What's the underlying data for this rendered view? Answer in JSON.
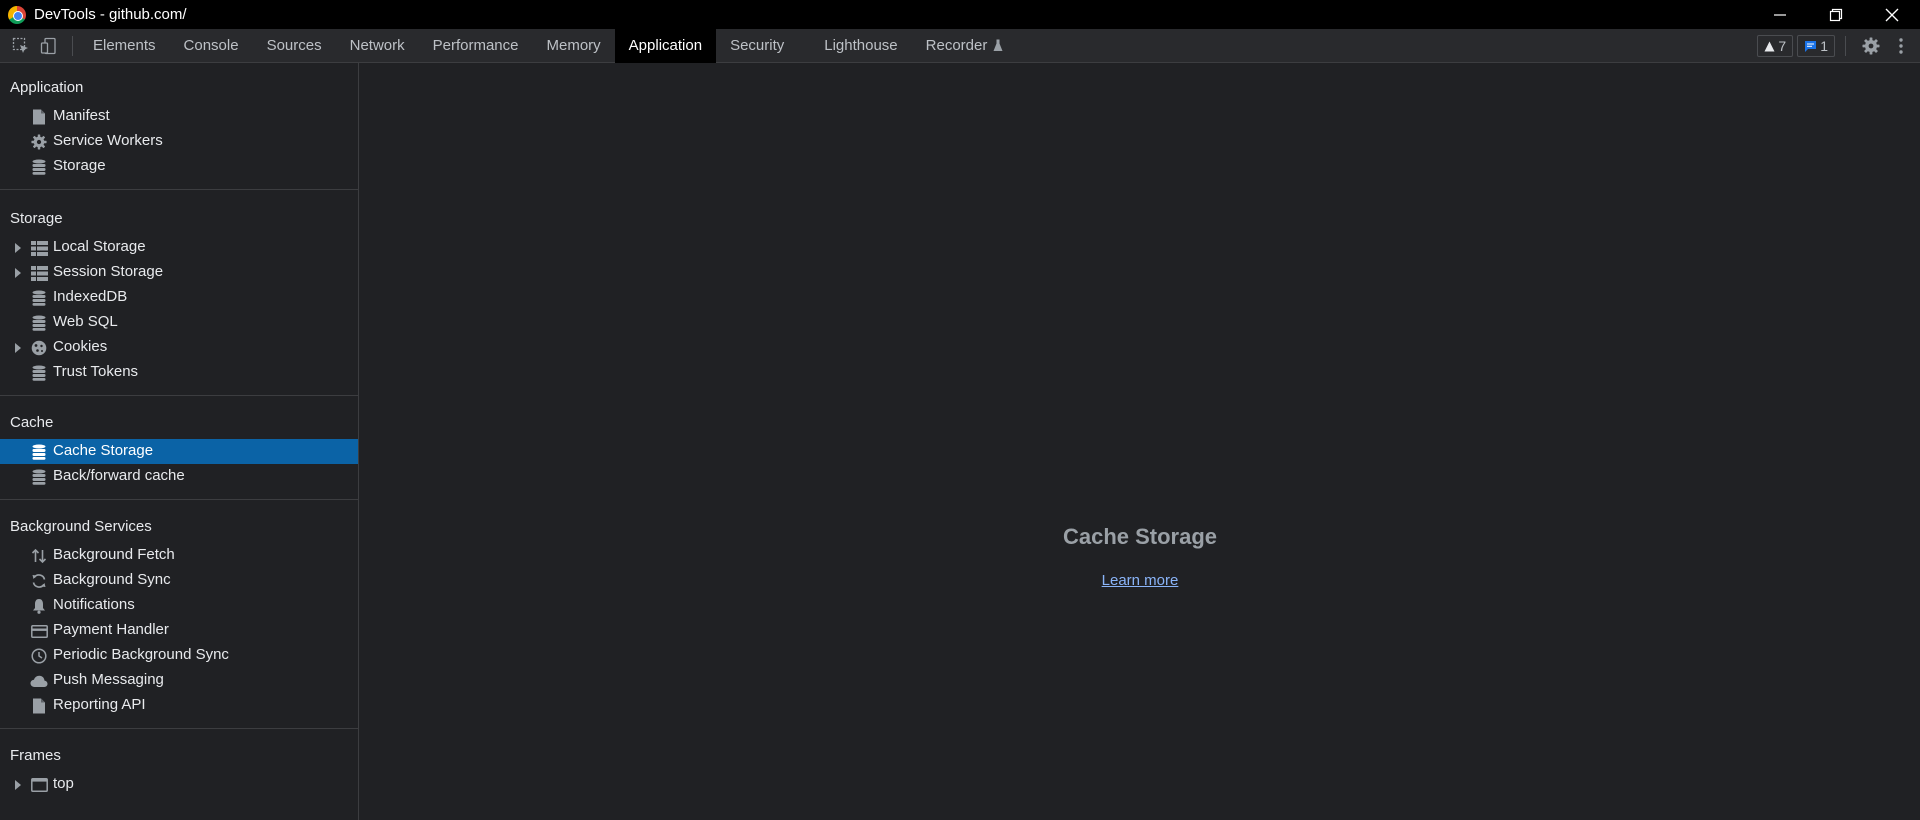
{
  "window": {
    "title": "DevTools - github.com/",
    "controls": [
      "minimize-icon",
      "restore-icon",
      "close-icon"
    ]
  },
  "toolbar": {
    "tabs": [
      {
        "label": "Elements"
      },
      {
        "label": "Console"
      },
      {
        "label": "Sources"
      },
      {
        "label": "Network"
      },
      {
        "label": "Performance"
      },
      {
        "label": "Memory"
      },
      {
        "label": "Application",
        "active": true
      },
      {
        "label": "Security"
      },
      {
        "label": "Lighthouse"
      },
      {
        "label": "Recorder",
        "icon": "flask-icon"
      }
    ],
    "warnings_count": "7",
    "messages_count": "1"
  },
  "sidebar": {
    "application": {
      "title": "Application",
      "items": [
        {
          "label": "Manifest",
          "icon": "document-icon"
        },
        {
          "label": "Service Workers",
          "icon": "gear-icon"
        },
        {
          "label": "Storage",
          "icon": "database-icon"
        }
      ]
    },
    "storage": {
      "title": "Storage",
      "items": [
        {
          "label": "Local Storage",
          "icon": "table-icon",
          "expandable": true
        },
        {
          "label": "Session Storage",
          "icon": "table-icon",
          "expandable": true
        },
        {
          "label": "IndexedDB",
          "icon": "database-icon"
        },
        {
          "label": "Web SQL",
          "icon": "database-icon"
        },
        {
          "label": "Cookies",
          "icon": "cookie-icon",
          "expandable": true
        },
        {
          "label": "Trust Tokens",
          "icon": "database-icon"
        }
      ]
    },
    "cache": {
      "title": "Cache",
      "items": [
        {
          "label": "Cache Storage",
          "icon": "database-icon",
          "selected": true
        },
        {
          "label": "Back/forward cache",
          "icon": "database-icon"
        }
      ]
    },
    "background": {
      "title": "Background Services",
      "items": [
        {
          "label": "Background Fetch",
          "icon": "up-down-arrows-icon"
        },
        {
          "label": "Background Sync",
          "icon": "sync-icon"
        },
        {
          "label": "Notifications",
          "icon": "bell-icon"
        },
        {
          "label": "Payment Handler",
          "icon": "credit-card-icon"
        },
        {
          "label": "Periodic Background Sync",
          "icon": "clock-icon"
        },
        {
          "label": "Push Messaging",
          "icon": "cloud-icon"
        },
        {
          "label": "Reporting API",
          "icon": "document-icon"
        }
      ]
    },
    "frames": {
      "title": "Frames",
      "items": [
        {
          "label": "top",
          "icon": "frame-icon",
          "expandable": true
        }
      ]
    }
  },
  "main": {
    "title": "Cache Storage",
    "link": "Learn more"
  },
  "colors": {
    "selected": "#0b63a6",
    "link": "#8ab4f8",
    "messages_accent": "#1a73e8"
  }
}
